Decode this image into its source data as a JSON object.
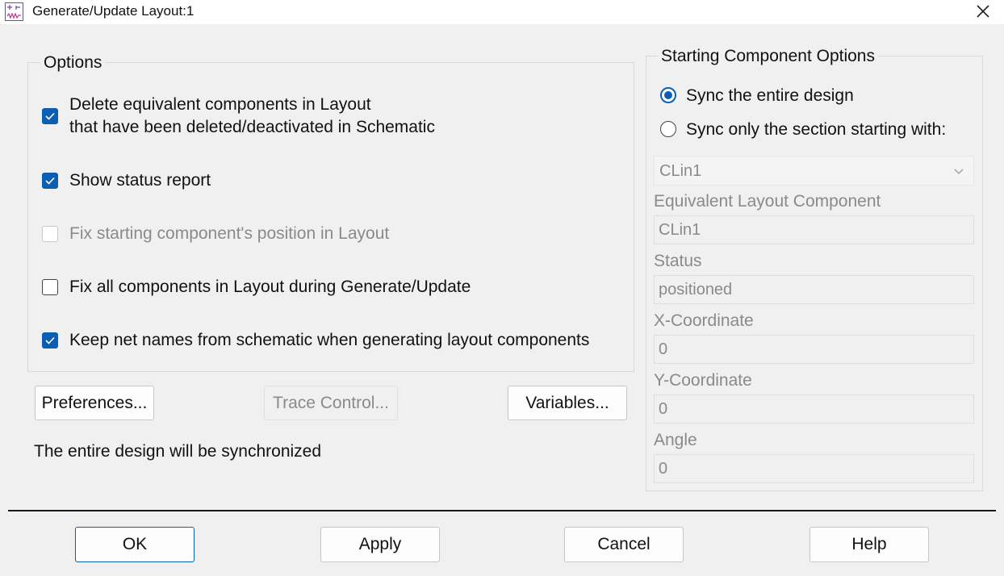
{
  "window": {
    "title": "Generate/Update Layout:1",
    "icon": "schematic-layout-icon",
    "close_icon": "close-icon"
  },
  "options": {
    "title": "Options",
    "items": [
      {
        "line1": "Delete equivalent components in Layout",
        "line2": "that have been deleted/deactivated in Schematic",
        "checked": true,
        "enabled": true
      },
      {
        "label": "Show status report",
        "checked": true,
        "enabled": true
      },
      {
        "label": "Fix starting component's position in Layout",
        "checked": false,
        "enabled": false
      },
      {
        "label": "Fix all components in Layout during Generate/Update",
        "checked": false,
        "enabled": true
      },
      {
        "label": "Keep net names from schematic when generating layout components",
        "checked": true,
        "enabled": true
      }
    ]
  },
  "buttons": {
    "preferences": "Preferences...",
    "trace_control": "Trace Control...",
    "variables": "Variables..."
  },
  "status_message": "The entire design will be synchronized",
  "starting": {
    "title": "Starting Component Options",
    "radio_entire": "Sync the entire design",
    "radio_section": "Sync only the section starting with:",
    "selected": "entire",
    "component_select": "CLin1",
    "equiv_label": "Equivalent Layout Component",
    "equiv_value": "CLin1",
    "status_label": "Status",
    "status_value": "positioned",
    "x_label": "X-Coordinate",
    "x_value": "0",
    "y_label": "Y-Coordinate",
    "y_value": "0",
    "angle_label": "Angle",
    "angle_value": "0"
  },
  "footer": {
    "ok": "OK",
    "apply": "Apply",
    "cancel": "Cancel",
    "help": "Help"
  },
  "colors": {
    "accent": "#0a5fb4",
    "dialog_bg": "#f0f0f0",
    "disabled_text": "#8a8a8a"
  }
}
